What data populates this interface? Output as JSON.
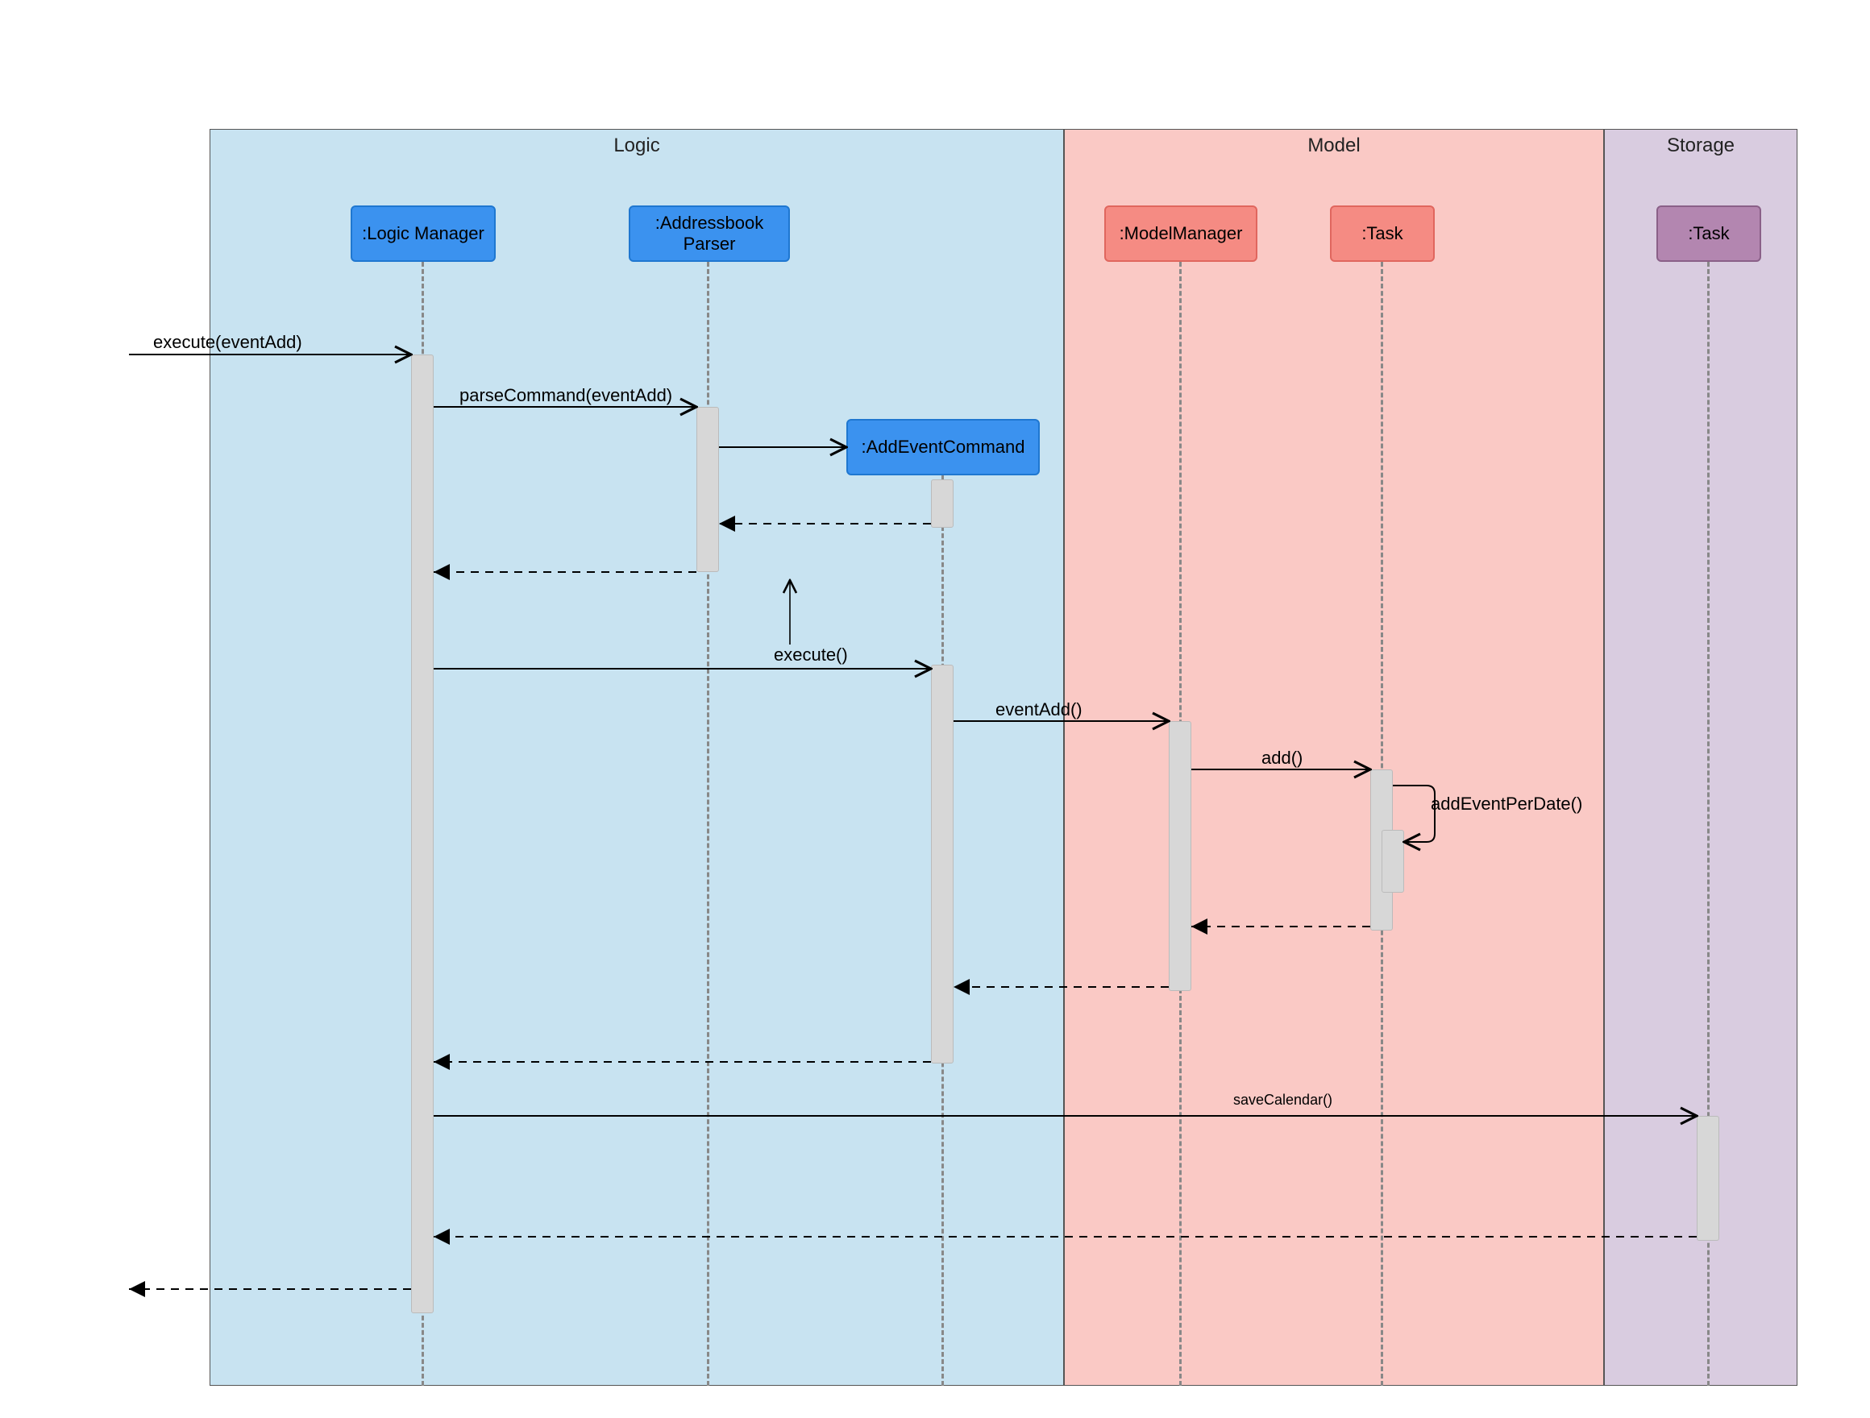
{
  "diagram_type": "UML Sequence Diagram",
  "regions": {
    "logic": {
      "title": "Logic",
      "color": "#c8e3f1"
    },
    "model": {
      "title": "Model",
      "color": "#fac9c5"
    },
    "storage": {
      "title": "Storage",
      "color": "#d9cce0"
    }
  },
  "lifelines": {
    "logic_manager": {
      "label": ":Logic Manager",
      "region": "logic",
      "style": "blue"
    },
    "addressbook": {
      "label": ":Addressbook Parser",
      "region": "logic",
      "style": "blue"
    },
    "add_event_cmd": {
      "label": ":AddEventCommand",
      "region": "logic",
      "style": "blue",
      "created_mid": true
    },
    "model_manager": {
      "label": ":ModelManager",
      "region": "model",
      "style": "red"
    },
    "task_model": {
      "label": ":Task",
      "region": "model",
      "style": "red"
    },
    "task_storage": {
      "label": ":Task",
      "region": "storage",
      "style": "purple"
    }
  },
  "messages": [
    {
      "id": "m1",
      "from": "external",
      "to": "logic_manager",
      "label": "execute(eventAdd)",
      "type": "call"
    },
    {
      "id": "m2",
      "from": "logic_manager",
      "to": "addressbook",
      "label": "parseCommand(eventAdd)",
      "type": "call"
    },
    {
      "id": "m3",
      "from": "addressbook",
      "to": "add_event_cmd",
      "label": "",
      "type": "create"
    },
    {
      "id": "m4",
      "from": "add_event_cmd",
      "to": "addressbook",
      "label": "",
      "type": "return"
    },
    {
      "id": "m5",
      "from": "addressbook",
      "to": "logic_manager",
      "label": "",
      "type": "return"
    },
    {
      "id": "m6",
      "from": "logic_manager",
      "to": "add_event_cmd",
      "label": "execute()",
      "type": "call"
    },
    {
      "id": "m7",
      "from": "add_event_cmd",
      "to": "model_manager",
      "label": "eventAdd()",
      "type": "call"
    },
    {
      "id": "m8",
      "from": "model_manager",
      "to": "task_model",
      "label": "add()",
      "type": "call"
    },
    {
      "id": "m9",
      "from": "task_model",
      "to": "task_model",
      "label": "addEventPerDate()",
      "type": "self"
    },
    {
      "id": "m10",
      "from": "task_model",
      "to": "model_manager",
      "label": "",
      "type": "return"
    },
    {
      "id": "m11",
      "from": "model_manager",
      "to": "add_event_cmd",
      "label": "",
      "type": "return"
    },
    {
      "id": "m12",
      "from": "add_event_cmd",
      "to": "logic_manager",
      "label": "",
      "type": "return"
    },
    {
      "id": "m13",
      "from": "logic_manager",
      "to": "task_storage",
      "label": "saveCalendar()",
      "type": "call"
    },
    {
      "id": "m14",
      "from": "task_storage",
      "to": "logic_manager",
      "label": "",
      "type": "return"
    },
    {
      "id": "m15",
      "from": "logic_manager",
      "to": "external",
      "label": "",
      "type": "return"
    }
  ]
}
